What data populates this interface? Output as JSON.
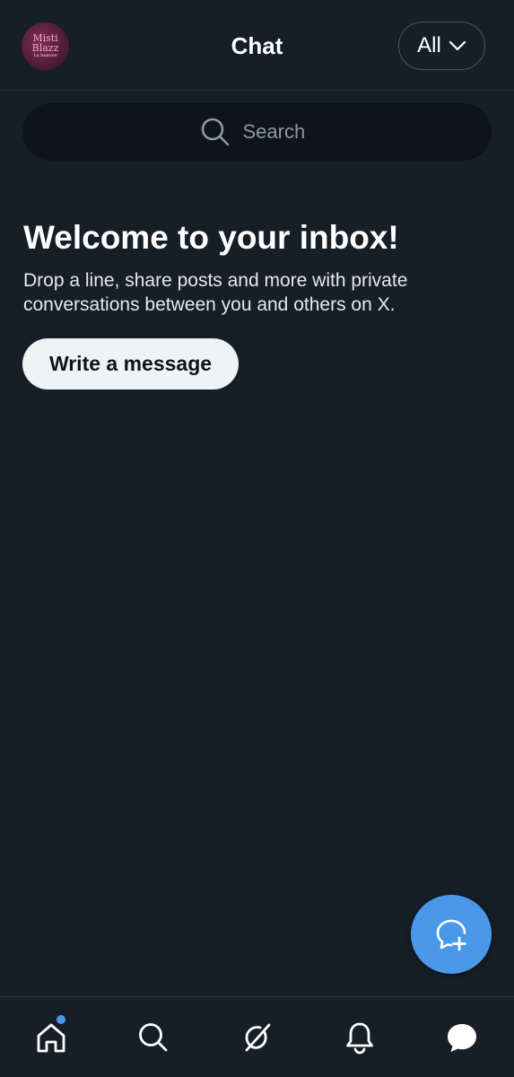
{
  "header": {
    "avatar_text": [
      "Misti",
      "Blazz",
      "La bamoie"
    ],
    "title": "Chat",
    "filter_label": "All"
  },
  "search": {
    "placeholder": "Search"
  },
  "welcome": {
    "title": "Welcome to your inbox!",
    "body": "Drop a line, share posts and more with private conversations between you and others on X.",
    "button_label": "Write a message"
  },
  "bottom_nav": {
    "items": [
      {
        "icon": "home-icon",
        "has_notification_dot": true
      },
      {
        "icon": "search-icon"
      },
      {
        "icon": "grok-icon"
      },
      {
        "icon": "bell-icon"
      },
      {
        "icon": "chat-bubble-icon",
        "active": true
      }
    ]
  },
  "colors": {
    "background": "#161e27",
    "accent": "#4a99e9",
    "search_bg": "#0f141b",
    "button_bg": "#eff3f4"
  }
}
